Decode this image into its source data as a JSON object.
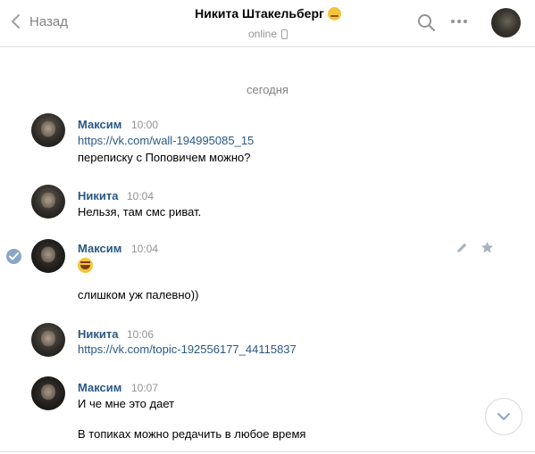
{
  "header": {
    "back_label": "Назад",
    "title": "Никита Штакельберг",
    "status": "online"
  },
  "date_separator": "сегодня",
  "messages": [
    {
      "author": "Максим",
      "time": "10:00",
      "lines": [
        "https://vk.com/wall-194995085_15",
        "переписку с Поповичем можно?"
      ]
    },
    {
      "author": "Никита",
      "time": "10:04",
      "lines": [
        "Нельзя, там смс риват."
      ]
    },
    {
      "author": "Максим",
      "time": "10:04",
      "lines": [
        "слишком уж палевно))"
      ]
    },
    {
      "author": "Никита",
      "time": "10:06",
      "lines": [
        "https://vk.com/topic-192556177_44115837"
      ]
    },
    {
      "author": "Максим",
      "time": "10:07",
      "lines": [
        "И че мне это дает",
        "В топиках можно редачить в любое время"
      ]
    }
  ],
  "icons": {
    "back": "chevron-left-icon",
    "search": "search-icon",
    "more": "more-dots-icon",
    "phone": "mobile-phone-icon",
    "selected": "check-circle-icon",
    "edit": "pencil-icon",
    "favorite": "star-icon",
    "scroll_down": "chevron-down-icon",
    "emoji": "laughing-emoji-icon"
  },
  "colors": {
    "link": "#2a5885",
    "secondary_text": "#939393",
    "check_badge": "#8ba5c6"
  }
}
